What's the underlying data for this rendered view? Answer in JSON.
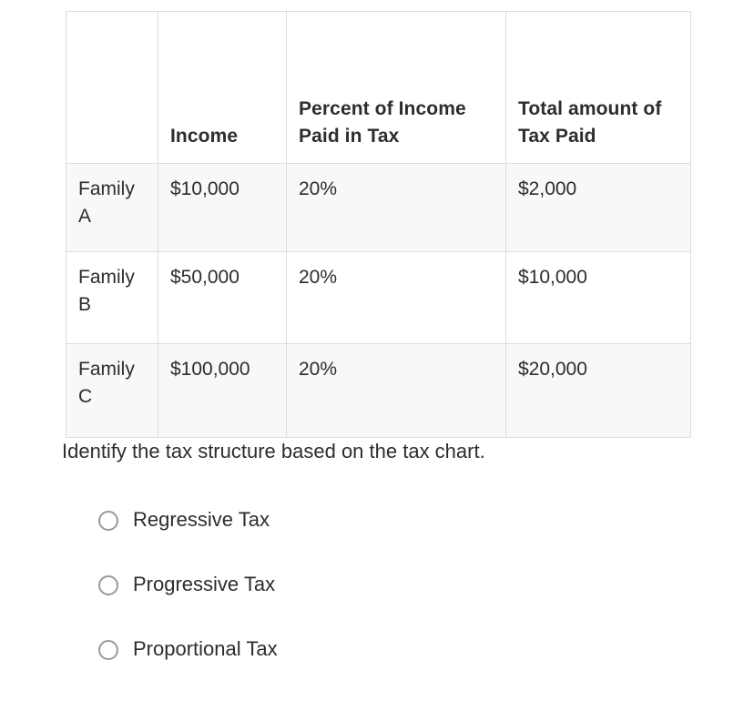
{
  "table": {
    "headers": [
      "",
      "Income",
      "Percent of Income Paid in Tax",
      "Total amount of Tax Paid"
    ],
    "rows": [
      {
        "family": "Family A",
        "income": "$10,000",
        "percent": "20%",
        "total": "$2,000"
      },
      {
        "family": "Family B",
        "income": "$50,000",
        "percent": "20%",
        "total": "$10,000"
      },
      {
        "family": "Family C",
        "income": "$100,000",
        "percent": "20%",
        "total": "$20,000"
      }
    ]
  },
  "question": {
    "prompt": "Identify the tax structure based on the tax chart."
  },
  "options": [
    {
      "label": "Regressive Tax",
      "selected": false
    },
    {
      "label": "Progressive Tax",
      "selected": false
    },
    {
      "label": "Proportional Tax",
      "selected": false
    }
  ],
  "colors": {
    "text": "#2d2d2d",
    "border": "#dddddd",
    "stripe": "#f8f8f8",
    "radio_border": "#9a9a9a",
    "background": "#ffffff"
  }
}
